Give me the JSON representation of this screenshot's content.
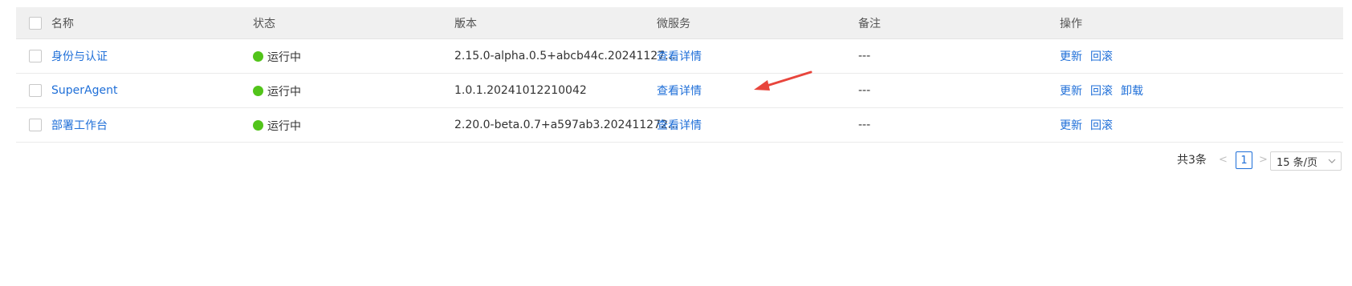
{
  "table": {
    "columns": [
      "名称",
      "状态",
      "版本",
      "微服务",
      "备注",
      "操作"
    ],
    "rows": [
      {
        "name": "身份与认证",
        "status": "运行中",
        "version": "2.15.0-alpha.0.5+abcb44c.20241127...",
        "microservice": "查看详情",
        "note": "---",
        "actions": [
          "更新",
          "回滚"
        ]
      },
      {
        "name": "SuperAgent",
        "status": "运行中",
        "version": "1.0.1.20241012210042",
        "microservice": "查看详情",
        "note": "---",
        "actions": [
          "更新",
          "回滚",
          "卸载"
        ]
      },
      {
        "name": "部署工作台",
        "status": "运行中",
        "version": "2.20.0-beta.0.7+a597ab3.202411272...",
        "microservice": "查看详情",
        "note": "---",
        "actions": [
          "更新",
          "回滚"
        ]
      }
    ]
  },
  "pagination": {
    "total": "共3条",
    "current_page": "1",
    "page_size": "15 条/页"
  },
  "colors": {
    "link": "#1f6fd8",
    "status_running": "#52c41a",
    "header_bg": "#f0f0f0",
    "annotation_arrow": "#e8453c"
  }
}
